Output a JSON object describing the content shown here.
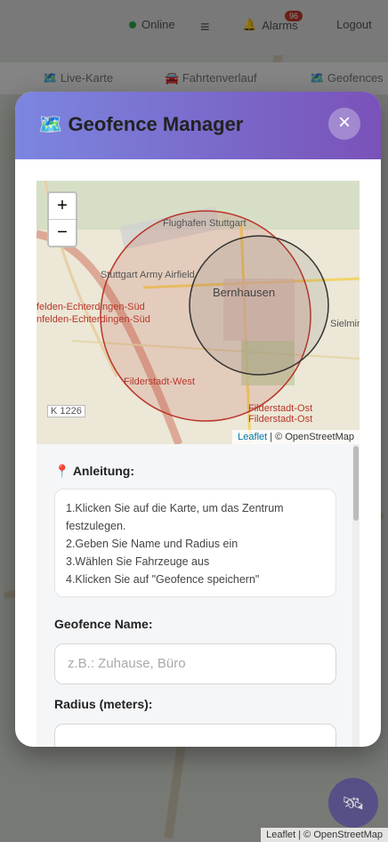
{
  "background": {
    "topbar": {
      "status": "Online",
      "alarms_label": "Alarms",
      "alarms_count": "96",
      "logout": "Logout"
    },
    "tabs": [
      "Live-Karte",
      "Fahrtenverlauf",
      "Geofences"
    ],
    "attribution": {
      "leaflet": "Leaflet",
      "sep": "|",
      "osm": "© OpenStreetMap"
    }
  },
  "modal": {
    "icon": "🗺️",
    "title": "Geofence Manager",
    "close": "×",
    "map": {
      "zoom_in": "+",
      "zoom_out": "−",
      "labels": {
        "flughafen": "Flughafen Stuttgart",
        "army": "Stuttgart Army Airfield",
        "bernhausen": "Bernhausen",
        "sielmin": "Sielmin",
        "echter1": "felden-Echterdingen-Süd",
        "echter2": "nfelden-Echterdingen-Süd",
        "filderstadt_west": "Filderstadt-West",
        "filderstadt_ost1": "Filderstadt-Ost",
        "filderstadt_ost2": "Filderstadt-Ost",
        "k1226": "K 1226"
      },
      "attribution": {
        "leaflet": "Leaflet",
        "sep": "|",
        "osm": "© OpenStreetMap"
      }
    },
    "instructions": {
      "heading_icon": "📍",
      "heading": "Anleitung:",
      "lines": [
        "1.Klicken Sie auf die Karte, um das Zentrum",
        "festzulegen.",
        "2.Geben Sie Name und Radius ein",
        "3.Wählen Sie Fahrzeuge aus",
        "4.Klicken Sie auf \"Geofence speichern\""
      ]
    },
    "name_label": "Geofence Name:",
    "name_placeholder": "z.B.: Zuhause, Büro",
    "radius_label": "Radius (meters):"
  },
  "colors": {
    "header_start": "#7b86e0",
    "header_end": "#7a52b9",
    "circle_red": "#b8362a",
    "circle_dark": "#333333"
  }
}
